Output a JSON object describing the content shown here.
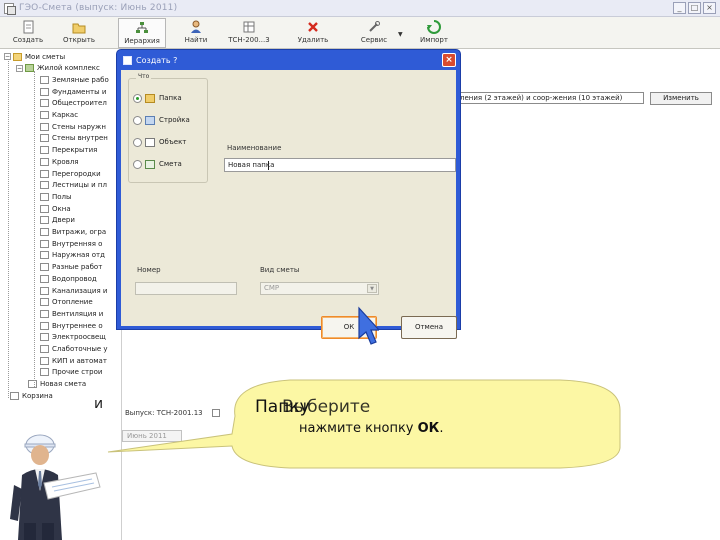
{
  "window": {
    "title": "ГЭО-Смета (выпуск: Июнь 2011)",
    "minimize": "_",
    "maximize": "□",
    "close": "×"
  },
  "toolbar": {
    "buttons": [
      {
        "label": "Создать",
        "icon": "create-doc-icon"
      },
      {
        "label": "Открыть",
        "icon": "open-folder-icon"
      },
      {
        "label": "Иерархия",
        "icon": "hierarchy-icon"
      },
      {
        "label": "Найти",
        "icon": "find-user-icon"
      },
      {
        "label": "ТСН-200...3",
        "icon": "catalog-icon"
      },
      {
        "label": "Удалить",
        "icon": "delete-x-icon"
      },
      {
        "label": "Сервис",
        "icon": "service-tools-icon"
      },
      {
        "label": "Импорт",
        "icon": "import-icon"
      }
    ],
    "dropdown_arrow": "▼"
  },
  "tree": {
    "root": "Мои сметы",
    "project": "Жилой комплекс",
    "items": [
      "Земляные рабо",
      "Фундаменты и",
      "Общестроител",
      "Каркас",
      "Стены наружн",
      "Стены внутрен",
      "Перекрытия",
      "Кровля",
      "Перегородки",
      "Лестницы и пл",
      "Полы",
      "Окна",
      "Двери",
      "Витражи, огра",
      "Внутренняя о",
      "Наружная отд",
      "Разные работ",
      "Водопровод",
      "Канализация и",
      "Отопление",
      "Вентиляция и",
      "Внутреннее о",
      "Электроосвещ",
      "Слаботочные у",
      "КИП и автомат",
      "Прочие строи"
    ],
    "new_estimate": "Новая смета",
    "basket": "Корзина"
  },
  "behind": {
    "field_value": "ления (2 этажей) и соор-жения (10 этажей)",
    "change_button": "Изменить",
    "issue_label": "Выпуск: ТСН-2001.13",
    "issue_value": "Июнь 2011",
    "stray_letter": "и"
  },
  "dialog": {
    "title": "Создать ?",
    "close": "×",
    "group_label": "Что",
    "options": [
      {
        "label": "Папка",
        "checked": true,
        "icon": "folder-icon"
      },
      {
        "label": "Стройка",
        "checked": false,
        "icon": "construction-icon"
      },
      {
        "label": "Объект",
        "checked": false,
        "icon": "object-icon"
      },
      {
        "label": "Смета",
        "checked": false,
        "icon": "estimate-icon"
      }
    ],
    "name_label": "Наименование",
    "name_value": "Новая папка",
    "number_label": "Номер",
    "kind_label": "Вид сметы",
    "kind_value": "СМР",
    "ok_label": "ОК",
    "cancel_label": "Отмена"
  },
  "hint": {
    "line1_a": "Папку",
    "line1_b": "Выберите",
    "line2_prefix": "нажмите кнопку ",
    "line2_bold": "ОК",
    "line2_suffix": "."
  },
  "colors": {
    "dialog_frame": "#2f5bd6",
    "dialog_body": "#ece9d8",
    "balloon_fill": "#fcf7a4",
    "ok_focus": "#ef8a2a"
  }
}
